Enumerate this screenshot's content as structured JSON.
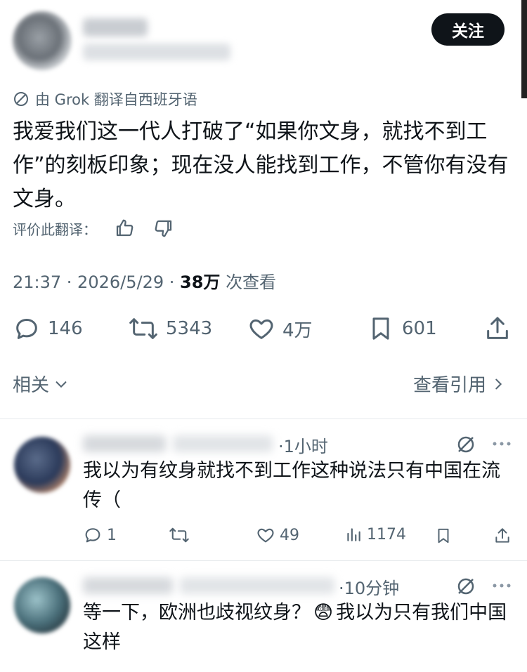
{
  "post": {
    "follow_label": "关注",
    "translated_note": "由 Grok 翻译自西班牙语",
    "text": "我爱我们这一代人打破了“如果你文身，就找不到工作”的刻板印象；现在没人能找到工作，不管你有没有文身。",
    "rate_label": "评价此翻译：",
    "timestamp": "21:37 · 2026/5/29 ·",
    "views_count": "38万",
    "views_label": "次查看",
    "stats": {
      "replies": "146",
      "reposts": "5343",
      "likes": "4万",
      "bookmarks": "601"
    },
    "related_label": "相关",
    "quotes_label": "查看引用"
  },
  "replies": [
    {
      "time": "·1小时",
      "text": "我以为有纹身就找不到工作这种说法只有中国在流传（",
      "replies": "1",
      "reposts": "",
      "likes": "49",
      "views": "1174"
    },
    {
      "time": "·10分钟",
      "text_part1": "等一下，欧洲也歧视纹身？",
      "emoji": "😨",
      "text_part2": "我以为只有我们中国这样"
    }
  ],
  "colors": {
    "text": "#0f1419",
    "secondary": "#536471",
    "button_bg": "#0f1419"
  },
  "icons": [
    "reply-icon",
    "repost-icon",
    "like-icon",
    "bookmark-icon",
    "share-icon",
    "views-icon",
    "thumbs-up-icon",
    "thumbs-down-icon",
    "translate-icon",
    "grok-icon",
    "more-icon",
    "chevron-down-icon",
    "chevron-right-icon"
  ]
}
